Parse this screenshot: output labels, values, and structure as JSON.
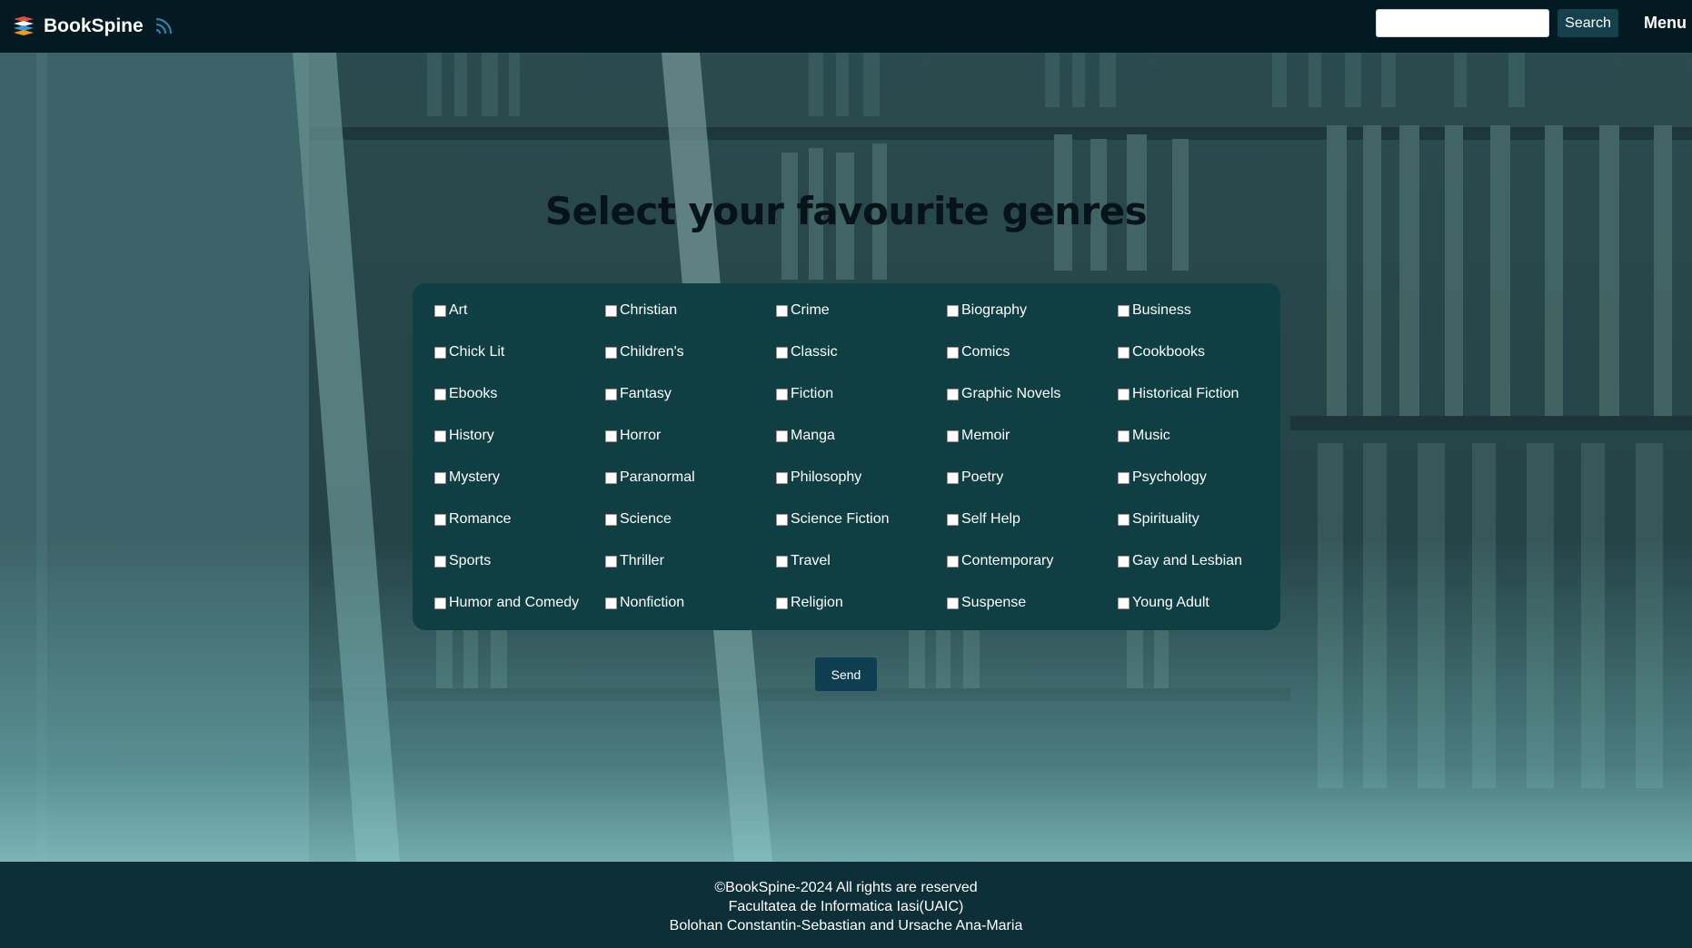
{
  "header": {
    "brand": "BookSpine",
    "logo_icon": "books-logo-icon",
    "feed_icon": "rss-feed-icon",
    "search_value": "",
    "search_placeholder": "",
    "search_button": "Search",
    "menu_button": "Menu"
  },
  "main": {
    "title": "Select your favourite genres",
    "genres": [
      "Art",
      "Christian",
      "Crime",
      "Biography",
      "Business",
      "Chick Lit",
      "Children's",
      "Classic",
      "Comics",
      "Cookbooks",
      "Ebooks",
      "Fantasy",
      "Fiction",
      "Graphic Novels",
      "Historical Fiction",
      "History",
      "Horror",
      "Manga",
      "Memoir",
      "Music",
      "Mystery",
      "Paranormal",
      "Philosophy",
      "Poetry",
      "Psychology",
      "Romance",
      "Science",
      "Science Fiction",
      "Self Help",
      "Spirituality",
      "Sports",
      "Thriller",
      "Travel",
      "Contemporary",
      "Gay and Lesbian",
      "Humor and Comedy",
      "Nonfiction",
      "Religion",
      "Suspense",
      "Young Adult"
    ],
    "send_button": "Send"
  },
  "footer": {
    "line1": "©BookSpine-2024 All rights are reserved",
    "line2": "Facultatea de Informatica Iasi(UAIC)",
    "line3": "Bolohan Constantin-Sebastian and Ursache Ana-Maria"
  },
  "colors": {
    "header_bg": "#041a22",
    "panel_bg": "#0f3f43",
    "footer_bg": "#0d3038",
    "button_bg": "#17404d",
    "title_text": "#06141a"
  }
}
